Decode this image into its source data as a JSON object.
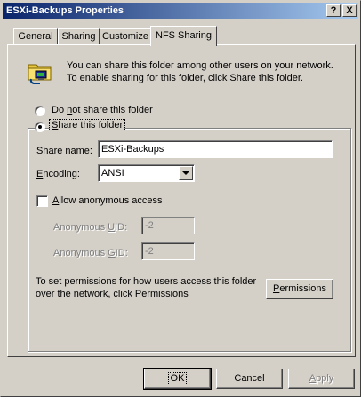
{
  "window": {
    "title": "ESXi-Backups Properties",
    "help_glyph": "?",
    "close_glyph": "X"
  },
  "tabs": [
    {
      "label": "General"
    },
    {
      "label": "Sharing"
    },
    {
      "label": "Customize"
    },
    {
      "label": "NFS Sharing",
      "active": true
    }
  ],
  "info": {
    "icon": "shared-folder-icon",
    "text": "You can share this folder among other users on your network. To enable sharing for this folder, click Share this folder."
  },
  "radios": {
    "do_not_share": {
      "prefix": "Do ",
      "mnemonic": "n",
      "suffix": "ot share this folder",
      "checked": false
    },
    "share": {
      "mnemonic": "S",
      "suffix": "hare this folder",
      "checked": true
    }
  },
  "share_name": {
    "label": "Share name:",
    "value": "ESXi-Backups"
  },
  "encoding": {
    "prefix": "",
    "mnemonic": "E",
    "suffix": "ncoding:",
    "value": "ANSI"
  },
  "anonymous": {
    "mnemonic": "A",
    "suffix": "llow anonymous access",
    "checked": false,
    "uid_prefix": "Anonymous ",
    "uid_mnemonic": "U",
    "uid_suffix": "ID:",
    "uid_value": "-2",
    "gid_prefix": "Anonymous ",
    "gid_mnemonic": "G",
    "gid_suffix": "ID:",
    "gid_value": "-2"
  },
  "permissions": {
    "text": "To set permissions for how users access this folder over the network, click Permissions",
    "button_mnemonic": "P",
    "button_suffix": "ermissions"
  },
  "footer": {
    "ok": "OK",
    "cancel": "Cancel",
    "apply_mnemonic": "A",
    "apply_suffix": "pply"
  }
}
